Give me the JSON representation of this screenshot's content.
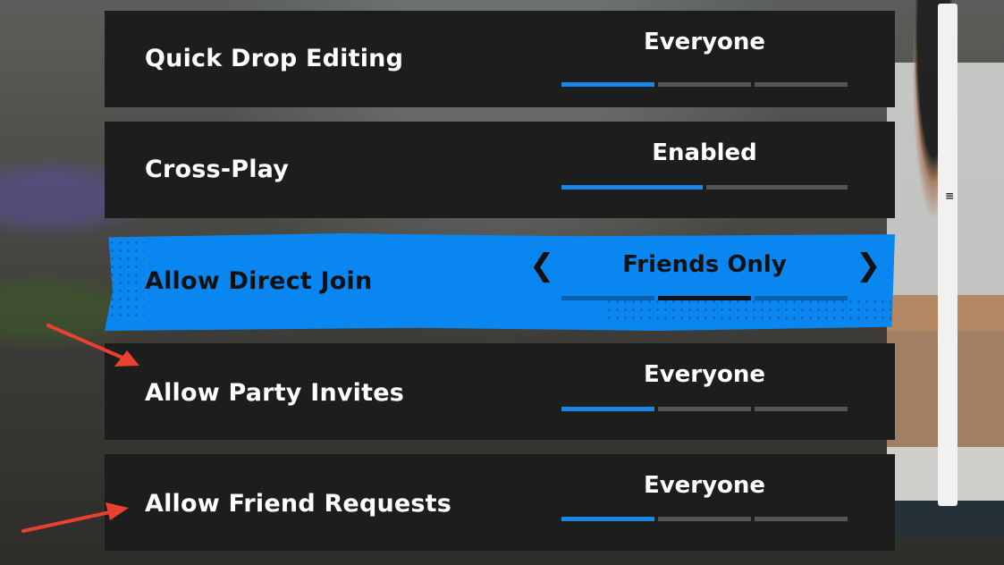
{
  "settings": [
    {
      "label": "Quick Drop Editing",
      "value": "Everyone",
      "segments": [
        true,
        false,
        false
      ]
    },
    {
      "label": "Cross-Play",
      "value": "Enabled",
      "segments": [
        true,
        false
      ]
    },
    {
      "label": "Allow Direct Join",
      "value": "Friends Only",
      "segments": [
        false,
        true,
        false
      ],
      "selected": true
    },
    {
      "label": "Allow Party Invites",
      "value": "Everyone",
      "segments": [
        true,
        false,
        false
      ]
    },
    {
      "label": "Allow Friend Requests",
      "value": "Everyone",
      "segments": [
        true,
        false,
        false
      ]
    }
  ],
  "icons": {
    "prev": "chevron-left-icon",
    "next": "chevron-right-icon",
    "annotation": "red-arrow-icon"
  },
  "colors": {
    "accent": "#0a86f0",
    "row_bg": "#1d1d1d",
    "annotation": "#e8412f"
  }
}
